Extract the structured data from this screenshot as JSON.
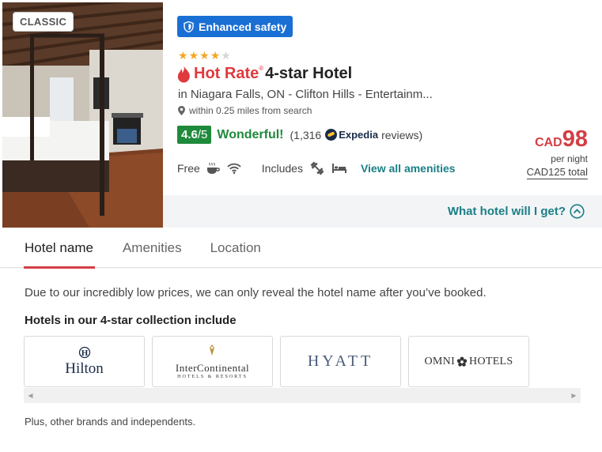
{
  "badge": "CLASSIC",
  "safety": {
    "label": "Enhanced safety",
    "icon": "shield-icon"
  },
  "rating_stars": {
    "filled": 4,
    "total": 5
  },
  "title": {
    "brand": "Hot Rate",
    "reg_mark": "®",
    "hotel_class": "4-star Hotel"
  },
  "location": "in Niagara Falls, ON - Clifton Hills - Entertainm...",
  "distance": "within 0.25 miles from search",
  "rating": {
    "score": "4.6",
    "denominator": "/5",
    "label": "Wonderful!",
    "count_prefix": "(1,316",
    "provider": "Expedia",
    "count_suffix": "reviews)"
  },
  "amenities": {
    "free_label": "Free",
    "includes_label": "Includes",
    "view_all": "View all amenities",
    "free_icons": [
      "coffee-icon",
      "wifi-icon"
    ],
    "includes_icons": [
      "fitness-icon",
      "bed-icon"
    ]
  },
  "price": {
    "currency": "CAD",
    "amount": "98",
    "per_night": "per night",
    "total": "CAD125 total"
  },
  "what_hotel": "What hotel will I get?",
  "tabs": [
    {
      "label": "Hotel name",
      "active": true
    },
    {
      "label": "Amenities",
      "active": false
    },
    {
      "label": "Location",
      "active": false
    }
  ],
  "hotel_name_panel": {
    "notice": "Due to our incredibly low prices, we can only reveal the hotel name after you’ve booked.",
    "collection_title": "Hotels in our 4-star collection include",
    "brands": [
      {
        "name": "Hilton",
        "mark": "H"
      },
      {
        "name": "InterContinental",
        "sub": "HOTELS & RESORTS"
      },
      {
        "name": "HYATT"
      },
      {
        "name_left": "OMNI",
        "name_right": "HOTELS"
      }
    ],
    "footer": "Plus, other brands and independents."
  },
  "colors": {
    "accent_red": "#d33f45",
    "teal_link": "#1a7f86",
    "rating_green": "#1f8a3b",
    "safety_blue": "#1a6fd4",
    "star_gold": "#f5a623"
  }
}
